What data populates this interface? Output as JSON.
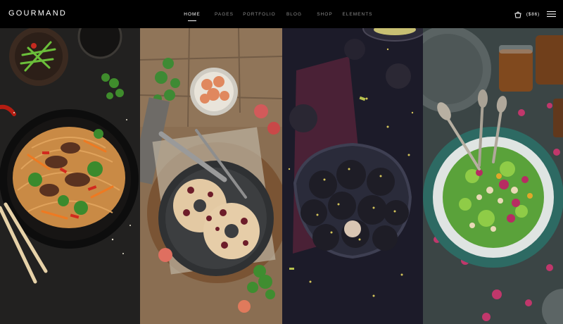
{
  "header": {
    "logo": "GOURMAND",
    "nav": [
      {
        "label": "HOME",
        "active": true
      },
      {
        "label": "PAGES",
        "active": false
      },
      {
        "label": "PORTFOLIO",
        "active": false
      },
      {
        "label": "BLOG",
        "active": false
      },
      {
        "label": "SHOP",
        "active": false
      },
      {
        "label": "ELEMENTS",
        "active": false
      }
    ],
    "cart_total": "($86)",
    "icons": {
      "cart": "shopping-bag-icon",
      "menu": "hamburger-menu-icon"
    }
  },
  "panels": [
    {
      "subject": "noodle-stir-fry-photo"
    },
    {
      "subject": "bagel-plate-photo"
    },
    {
      "subject": "truffle-balls-photo"
    },
    {
      "subject": "salad-bowl-photo"
    }
  ]
}
